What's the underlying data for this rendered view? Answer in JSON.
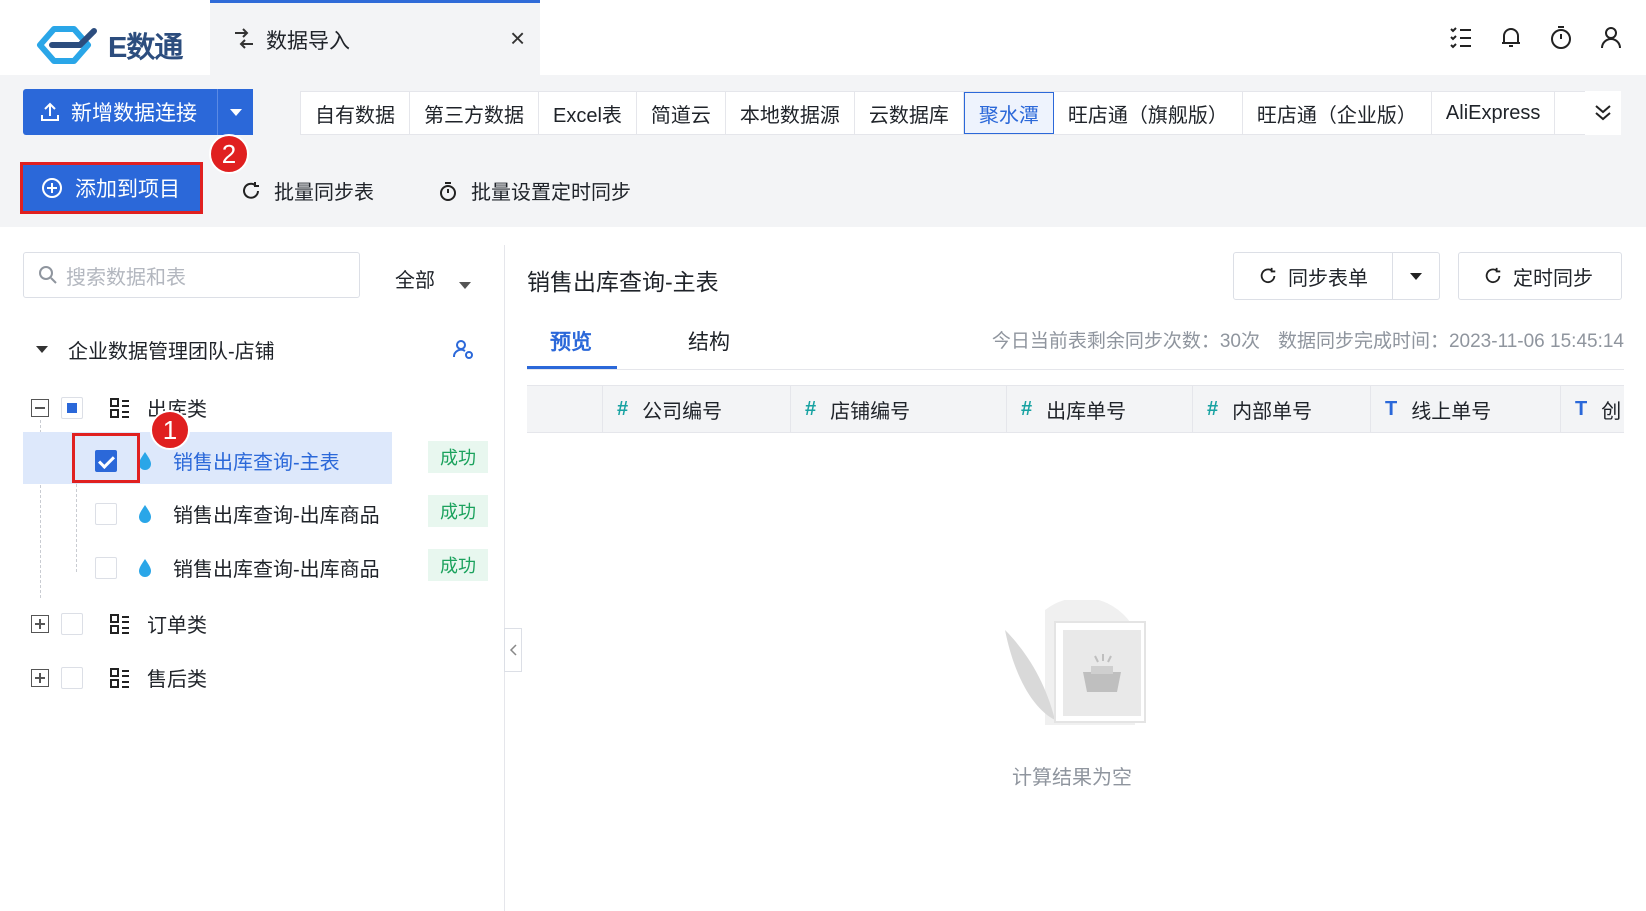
{
  "app": {
    "logo_text": "E数通"
  },
  "window_tab": {
    "label": "数据导入",
    "close": "×"
  },
  "top_icons": [
    "list-check-icon",
    "bell-icon",
    "timer-icon",
    "user-icon"
  ],
  "toolbar": {
    "new_connection": "新增数据连接",
    "source_tabs": [
      "自有数据",
      "第三方数据",
      "Excel表",
      "简道云",
      "本地数据源",
      "云数据库",
      "聚水潭",
      "旺店通（旗舰版）",
      "旺店通（企业版）",
      "AliExpress"
    ],
    "active_source": "聚水潭",
    "add_to_project": "添加到项目",
    "batch_sync": "批量同步表",
    "batch_schedule": "批量设置定时同步"
  },
  "badges": {
    "step1": "1",
    "step2": "2"
  },
  "left_panel": {
    "search_placeholder": "搜索数据和表",
    "filter": "全部",
    "root": "企业数据管理团队-店铺",
    "categories": [
      {
        "label": "出库类",
        "expanded": true,
        "check": "partial",
        "children": [
          {
            "label": "销售出库查询-主表",
            "status": "成功",
            "checked": true,
            "selected": true
          },
          {
            "label": "销售出库查询-出库商品",
            "status": "成功",
            "checked": false
          },
          {
            "label": "销售出库查询-出库商品",
            "status": "成功",
            "checked": false
          }
        ]
      },
      {
        "label": "订单类",
        "expanded": false,
        "check": "none"
      },
      {
        "label": "售后类",
        "expanded": false,
        "check": "none"
      }
    ]
  },
  "right_panel": {
    "title": "销售出库查询-主表",
    "sync_form": "同步表单",
    "scheduled_sync": "定时同步",
    "tabs": [
      "预览",
      "结构"
    ],
    "active_tab": "预览",
    "remaining_syncs": "今日当前表剩余同步次数：30次",
    "last_sync": "数据同步完成时间：2023-11-06 15:45:14",
    "columns": [
      {
        "type": "#",
        "name": "公司编号"
      },
      {
        "type": "#",
        "name": "店铺编号"
      },
      {
        "type": "#",
        "name": "出库单号"
      },
      {
        "type": "#",
        "name": "内部单号"
      },
      {
        "type": "T",
        "name": "线上单号"
      },
      {
        "type": "T",
        "name": "创"
      }
    ],
    "empty_text": "计算结果为空"
  },
  "colors": {
    "accent": "#2b68d9",
    "success": "#1ba25d",
    "annotation": "#e02020"
  }
}
